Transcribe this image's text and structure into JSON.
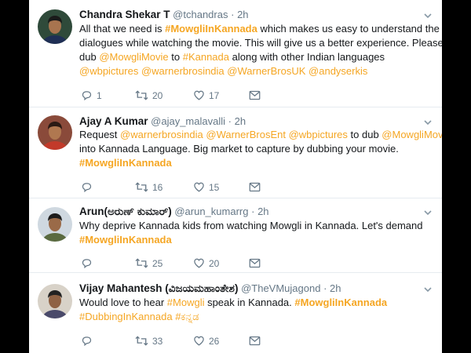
{
  "theme": {
    "accent": "#f5a623",
    "text": "#14171a",
    "muted": "#657786",
    "separator": "#e6ecf0",
    "background": "#000000"
  },
  "tweets": [
    {
      "name": "Chandra Shekar T",
      "handle": "@tchandras",
      "dot": "·",
      "time": "2h",
      "lines": [
        [
          {
            "t": "All that we need is ",
            "k": "text"
          },
          {
            "t": "#MowgliInKannada",
            "k": "tag"
          },
          {
            "t": " which makes us easy to understand the",
            "k": "text"
          }
        ],
        [
          {
            "t": "dialogues while watching the movie. This will give us a better experience. Please",
            "k": "text"
          }
        ],
        [
          {
            "t": "dub ",
            "k": "text"
          },
          {
            "t": "@MowgliMovie",
            "k": "link"
          },
          {
            "t": " to ",
            "k": "text"
          },
          {
            "t": "#Kannada",
            "k": "link"
          },
          {
            "t": " along with other Indian languages",
            "k": "text"
          }
        ],
        [
          {
            "t": "@wbpictures",
            "k": "link"
          },
          {
            "t": " ",
            "k": "text"
          },
          {
            "t": "@warnerbrosindia",
            "k": "link"
          },
          {
            "t": " ",
            "k": "text"
          },
          {
            "t": "@WarnerBrosUK",
            "k": "link"
          },
          {
            "t": " ",
            "k": "text"
          },
          {
            "t": "@andyserkis",
            "k": "link"
          }
        ]
      ],
      "replies": "1",
      "retweets": "20",
      "likes": "17",
      "avatar_icon": "user-photo-icon"
    },
    {
      "name": "Ajay A Kumar",
      "handle": "@ajay_malavalli",
      "dot": "·",
      "time": "2h",
      "lines": [
        [
          {
            "t": "Request ",
            "k": "text"
          },
          {
            "t": "@warnerbrosindia",
            "k": "link"
          },
          {
            "t": " ",
            "k": "text"
          },
          {
            "t": "@WarnerBrosEnt",
            "k": "link"
          },
          {
            "t": " ",
            "k": "text"
          },
          {
            "t": "@wbpictures",
            "k": "link"
          },
          {
            "t": " to dub ",
            "k": "text"
          },
          {
            "t": "@MowgliMovie",
            "k": "link"
          }
        ],
        [
          {
            "t": "into Kannada Language. Big market to capture by dubbing your movie.",
            "k": "text"
          }
        ],
        [
          {
            "t": "#MowgliInKannada",
            "k": "tag"
          }
        ]
      ],
      "replies": "",
      "retweets": "16",
      "likes": "15",
      "avatar_icon": "user-photo-icon"
    },
    {
      "name": "Arun(ಅರುಣ್ ಕುಮಾರ್)",
      "handle": "@arun_kumarrg",
      "dot": "·",
      "time": "2h",
      "lines": [
        [
          {
            "t": "Why deprive Kannada kids from watching Mowgli in Kannada. Let's demand",
            "k": "text"
          }
        ],
        [
          {
            "t": "#MowgliInKannada",
            "k": "tag"
          }
        ]
      ],
      "replies": "",
      "retweets": "25",
      "likes": "20",
      "avatar_icon": "user-photo-icon"
    },
    {
      "name": "Vijay Mahantesh (ವಿಜಯಮಹಾಂತೇಶ)",
      "handle": "@TheVMujagond",
      "dot": "·",
      "time": "2h",
      "lines": [
        [
          {
            "t": "Would love to hear ",
            "k": "text"
          },
          {
            "t": "#Mowgli",
            "k": "link"
          },
          {
            "t": " speak in Kannada. ",
            "k": "text"
          },
          {
            "t": "#MowgliInKannada",
            "k": "tag"
          }
        ],
        [
          {
            "t": "#DubbingInKannada",
            "k": "link"
          },
          {
            "t": " ",
            "k": "text"
          },
          {
            "t": "#ಕನ್ನಡ",
            "k": "link"
          }
        ]
      ],
      "replies": "",
      "retweets": "33",
      "likes": "26",
      "avatar_icon": "user-photo-icon"
    }
  ]
}
